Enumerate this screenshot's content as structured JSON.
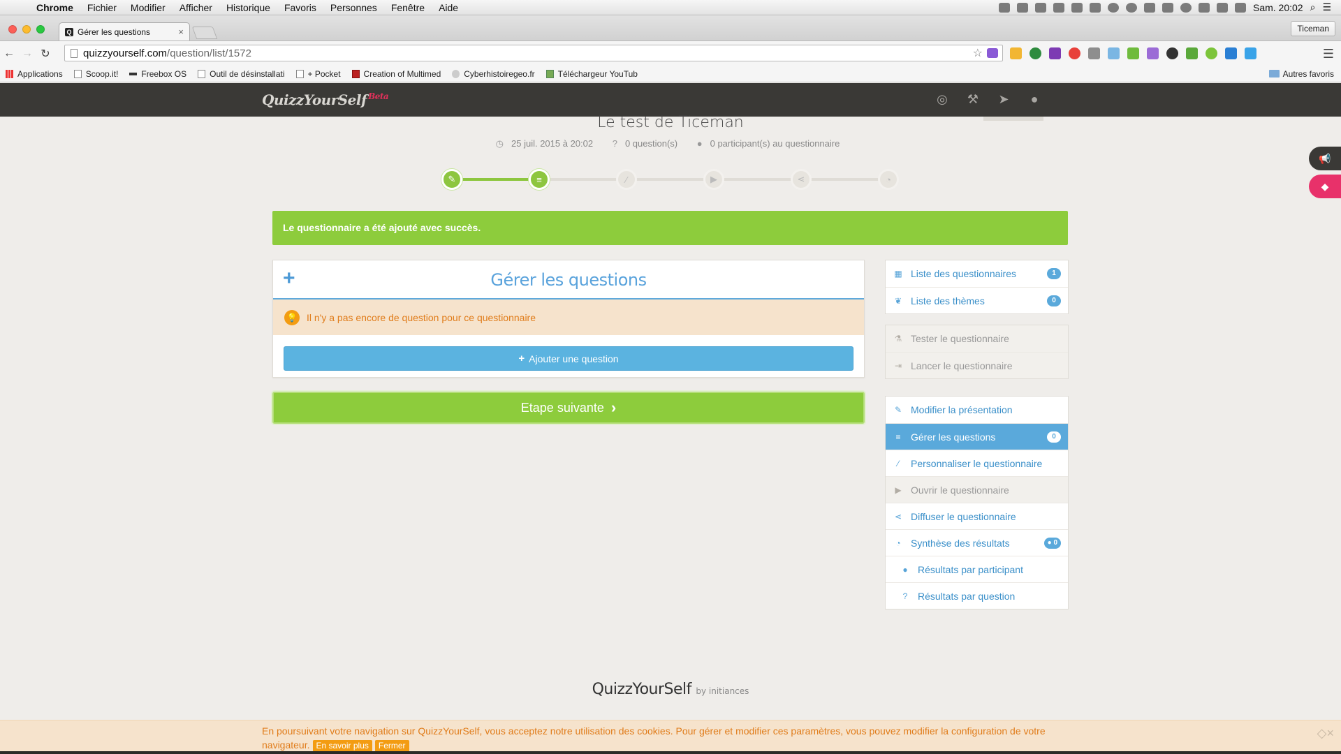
{
  "mac_menubar": {
    "app": "Chrome",
    "menus": [
      "Fichier",
      "Modifier",
      "Afficher",
      "Historique",
      "Favoris",
      "Personnes",
      "Fenêtre",
      "Aide"
    ],
    "clock": "Sam. 20:02"
  },
  "browser": {
    "tab_title": "Gérer les questions",
    "tab_favicon": "Q",
    "profile": "Ticeman",
    "url_host": "quizzyourself.com",
    "url_path": "/question/list/1572",
    "bookmarks": [
      {
        "label": "Applications",
        "icon": "apps-grid-icon"
      },
      {
        "label": "Scoop.it!",
        "icon": "page-icon"
      },
      {
        "label": "Freebox OS",
        "icon": "freebox-icon"
      },
      {
        "label": "Outil de désinstallati",
        "icon": "page-icon"
      },
      {
        "label": "+ Pocket",
        "icon": "page-icon"
      },
      {
        "label": "Creation of Multimed",
        "icon": "image-icon"
      },
      {
        "label": "Cyberhistoiregeo.fr",
        "icon": "owl-icon"
      },
      {
        "label": "Téléchargeur YouTub",
        "icon": "gem-icon"
      }
    ],
    "other_bookmarks": "Autres favoris"
  },
  "site": {
    "logo": "QuizzYourSelf",
    "logo_badge": "Beta",
    "header_icons": [
      "support-icon",
      "tools-icon",
      "send-icon",
      "user-icon"
    ]
  },
  "quiz": {
    "title": "Le test de Ticeman",
    "date": "25 juil. 2015 à 20:02",
    "questions_count": "0 question(s)",
    "participants": "0 participant(s) au questionnaire",
    "steps": [
      {
        "name": "edit",
        "icon": "pencil-icon",
        "done": true
      },
      {
        "name": "questions",
        "icon": "list-icon",
        "done": true
      },
      {
        "name": "customize",
        "icon": "brush-icon",
        "done": false
      },
      {
        "name": "open",
        "icon": "play-icon",
        "done": false
      },
      {
        "name": "share",
        "icon": "share-icon",
        "done": false
      },
      {
        "name": "results",
        "icon": "pie-icon",
        "done": false
      }
    ]
  },
  "alert": {
    "success": "Le questionnaire a été ajouté avec succès."
  },
  "questions_panel": {
    "title": "Gérer les questions",
    "empty_warning": "Il n'y a pas encore de question pour ce questionnaire",
    "add_button": "Ajouter une question",
    "next_button": "Etape suivante"
  },
  "sidebar": {
    "group1": [
      {
        "label": "Liste des questionnaires",
        "icon": "grid-icon",
        "badge": "1"
      },
      {
        "label": "Liste des thèmes",
        "icon": "leaf-icon",
        "badge": "0"
      }
    ],
    "group2": [
      {
        "label": "Tester le questionnaire",
        "icon": "flask-icon"
      },
      {
        "label": "Lancer le questionnaire",
        "icon": "sign-in-icon"
      }
    ],
    "group3": [
      {
        "label": "Modifier la présentation",
        "icon": "pencil-icon"
      },
      {
        "label": "Gérer les questions",
        "icon": "list-icon",
        "badge": "0"
      },
      {
        "label": "Personnaliser le questionnaire",
        "icon": "brush-icon"
      },
      {
        "label": "Ouvrir le questionnaire",
        "icon": "play-icon"
      },
      {
        "label": "Diffuser le questionnaire",
        "icon": "share-icon"
      },
      {
        "label": "Synthèse des résultats",
        "icon": "pie-icon",
        "badge": "0"
      },
      {
        "label": "Résultats par participant",
        "icon": "user-icon"
      },
      {
        "label": "Résultats par question",
        "icon": "question-icon"
      }
    ]
  },
  "footer": {
    "brand": "QuizzYourSelf",
    "by": "by initiances"
  },
  "cookie": {
    "text": "En poursuivant votre navigation sur QuizzYourSelf, vous acceptez notre utilisation des cookies. Pour gérer et modifier ces paramètres, vous pouvez modifier la configuration de votre navigateur.",
    "more": "En savoir plus",
    "close": "Fermer"
  },
  "colors": {
    "green": "#8dcc3c",
    "blue": "#5aa9db",
    "dark_header": "#3a3936",
    "warning_bg": "#f6e3cc",
    "warning_text": "#e07c1a"
  }
}
